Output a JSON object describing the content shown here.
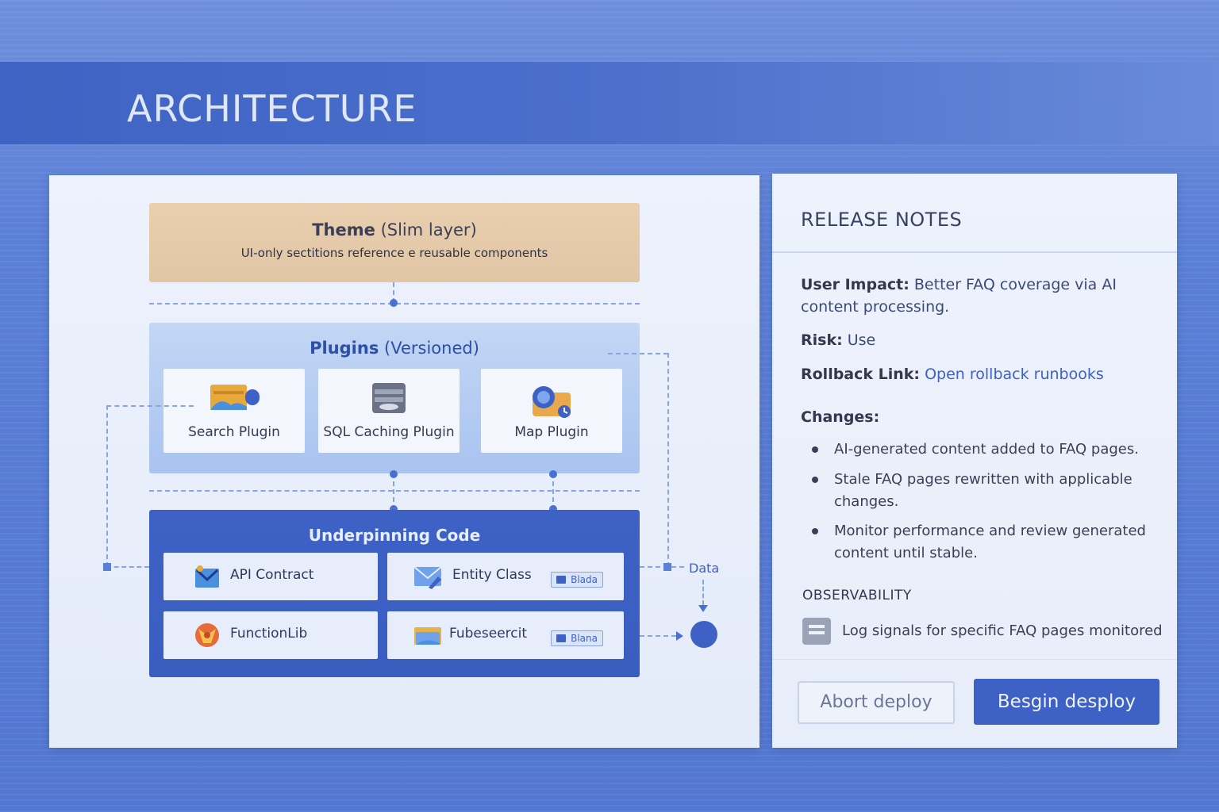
{
  "header": {
    "title": "ARCHITECTURE"
  },
  "architecture": {
    "theme": {
      "title": "Theme",
      "subtitle_paren": "(Slim layer)",
      "description": "UI-only sectitions reference e reusable components"
    },
    "plugins": {
      "title": "Plugins",
      "subtitle_paren": "(Versioned)",
      "items": [
        {
          "label": "Search Plugin",
          "icon": "search-plugin-icon"
        },
        {
          "label": "SQL Caching Plugin",
          "icon": "database-icon"
        },
        {
          "label": "Map Plugin",
          "icon": "map-icon"
        }
      ]
    },
    "underpinning": {
      "title": "Underpinning Code",
      "items": [
        {
          "label": "API Contract",
          "icon": "api-contract-icon",
          "tag": ""
        },
        {
          "label": "Entity Class",
          "icon": "entity-icon",
          "tag": "Blada"
        },
        {
          "label": "FunctionLib",
          "icon": "function-icon",
          "tag": ""
        },
        {
          "label": "Fubeseercit",
          "icon": "folder-icon",
          "tag": "Blana"
        }
      ]
    },
    "data_label": "Data"
  },
  "release_notes": {
    "title": "RELEASE NOTES",
    "user_impact": {
      "label": "User Impact:",
      "value": "Better FAQ coverage via AI content processing."
    },
    "risk": {
      "label": "Risk:",
      "value": "Use"
    },
    "rollback": {
      "label": "Rollback Link:",
      "link_text": "Open rollback runbooks"
    },
    "changes_title": "Changes:",
    "changes": [
      "AI-generated content added to FAQ pages.",
      "Stale FAQ pages rewritten with applicable changes.",
      "Monitor performance and review generated content until stable."
    ],
    "observability_title": "OBSERVABILITY",
    "observability_text": "Log signals for specific FAQ pages monitored",
    "buttons": {
      "abort": "Abort deploy",
      "begin": "Besgin desploy"
    }
  },
  "colors": {
    "accent": "#3d61c4",
    "theme_box": "#e9cfae",
    "plugins_box": "#b6cdf3"
  }
}
